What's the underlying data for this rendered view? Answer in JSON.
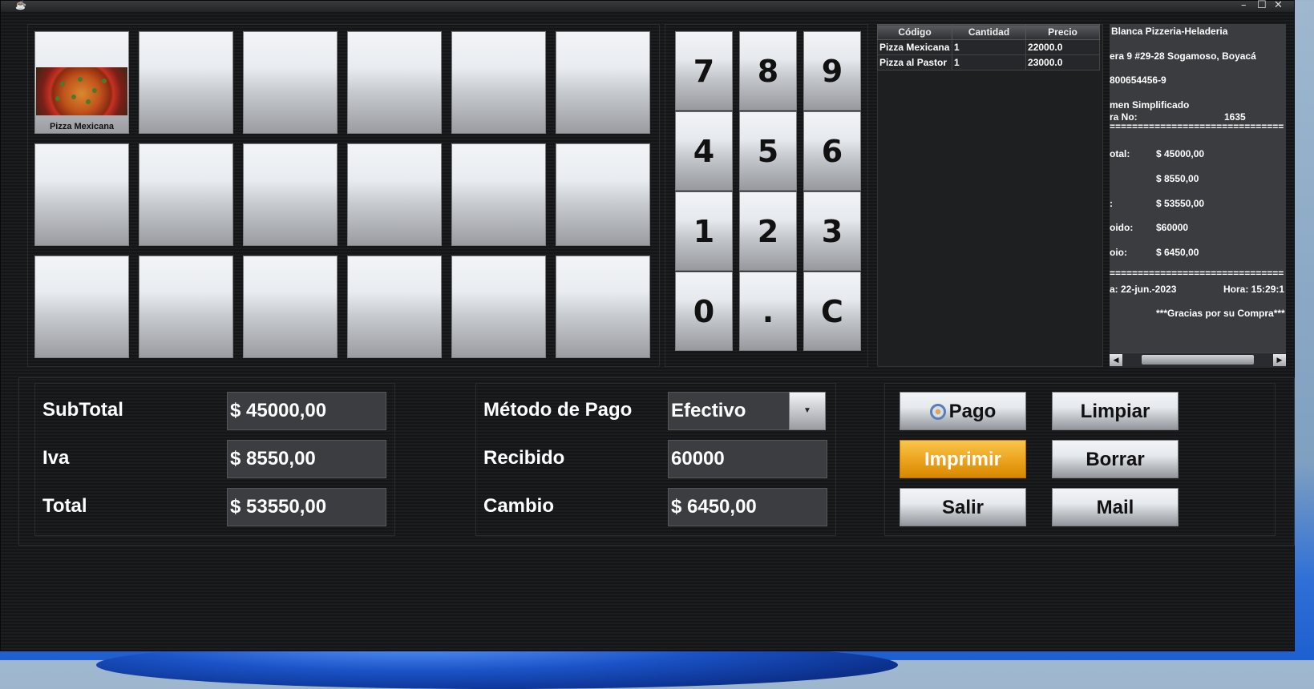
{
  "window": {
    "app_icon": "coffee-cup-icon",
    "minimize": "–",
    "maximize": "☐",
    "close": "✕"
  },
  "products": [
    {
      "label": "Pizza Mexicana",
      "has_image": true
    },
    {
      "label": ""
    },
    {
      "label": ""
    },
    {
      "label": ""
    },
    {
      "label": ""
    },
    {
      "label": ""
    },
    {
      "label": ""
    },
    {
      "label": ""
    },
    {
      "label": ""
    },
    {
      "label": ""
    },
    {
      "label": ""
    },
    {
      "label": ""
    },
    {
      "label": ""
    },
    {
      "label": ""
    },
    {
      "label": ""
    },
    {
      "label": ""
    },
    {
      "label": ""
    },
    {
      "label": ""
    }
  ],
  "keypad": [
    "7",
    "8",
    "9",
    "4",
    "5",
    "6",
    "1",
    "2",
    "3",
    "0",
    ".",
    "C"
  ],
  "items_table": {
    "headers": [
      "Código",
      "Cantidad",
      "Precio"
    ],
    "rows": [
      [
        "Pizza Mexicana",
        "1",
        "22000.0"
      ],
      [
        "Pizza al Pastor",
        "1",
        "23000.0"
      ]
    ]
  },
  "receipt": {
    "line1": "Blanca Pizzeria-Heladeria",
    "line2": "era 9 #29-28 Sogamoso, Boyacá",
    "line3": "800654456-9",
    "line4": "men Simplificado",
    "factura_label": "ra No:",
    "factura_no": "1635",
    "separator": "===============================",
    "subtotal_label": "otal:",
    "subtotal": "$ 45000,00",
    "iva": "$ 8550,00",
    "total_label": ":",
    "total": "$ 53550,00",
    "recibido_label": "oido:",
    "recibido": "$60000",
    "cambio_label": "oio:",
    "cambio": "$ 6450,00",
    "separator2": "===============================",
    "fecha": "a: 22-jun.-2023",
    "hora": "Hora: 15:29:1",
    "thanks": "***Gracias por su Compra***"
  },
  "totals": {
    "subtotal_label": "SubTotal",
    "subtotal_value": "$ 45000,00",
    "iva_label": "Iva",
    "iva_value": "$ 8550,00",
    "total_label": "Total",
    "total_value": "$ 53550,00"
  },
  "payment": {
    "method_label": "Método de Pago",
    "method_value": "Efectivo",
    "received_label": "Recibido",
    "received_value": "60000",
    "change_label": "Cambio",
    "change_value": "$ 6450,00"
  },
  "actions": {
    "pago": "Pago",
    "limpiar": "Limpiar",
    "imprimir": "Imprimir",
    "borrar": "Borrar",
    "salir": "Salir",
    "mail": "Mail"
  }
}
